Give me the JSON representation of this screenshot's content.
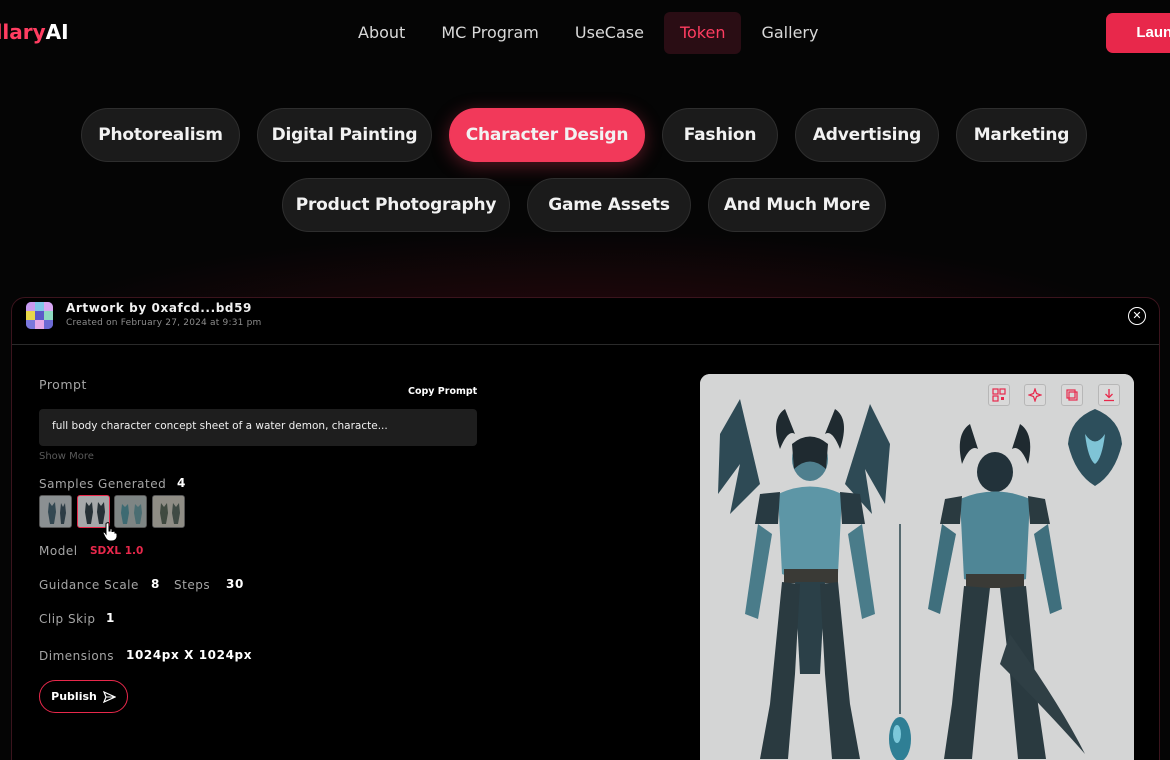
{
  "nav": {
    "logo_brand": "StellaryAI",
    "logo_brand_visible": "ellary",
    "logo_ai": "AI",
    "items": [
      "About",
      "MC Program",
      "UseCase",
      "Token",
      "Gallery"
    ],
    "active": "Token",
    "launch_label": "Launch"
  },
  "filters": {
    "items": [
      "Photorealism",
      "Digital Painting",
      "Character Design",
      "Fashion",
      "Advertising",
      "Marketing",
      "Product Photography",
      "Game Assets",
      "And Much More"
    ],
    "active": "Character Design"
  },
  "artwork_panel": {
    "artist": "Artwork by 0xafcd...bd59",
    "created": "Created on February 27, 2024 at 9:31 pm",
    "prompt_label": "Prompt",
    "copy_prompt": "Copy Prompt",
    "prompt_text": "full body character concept sheet of a water demon, characte...",
    "show_more": "Show More",
    "samples_label": "Samples Generated",
    "samples_count": "4",
    "model_label": "Model",
    "model_value": "SDXL 1.0",
    "guidance_label": "Guidance Scale",
    "guidance_value": "8",
    "steps_label": "Steps",
    "steps_value": "30",
    "clip_label": "Clip Skip",
    "clip_value": "1",
    "dimensions_label": "Dimensions",
    "dimensions_value": "1024px X 1024px",
    "publish_label": "Publish"
  },
  "colors": {
    "accent": "#e8284b",
    "chip_active": "#f2395a",
    "chip_bg": "#1b1b1b",
    "background": "#050505"
  },
  "icons": [
    "close-icon",
    "qr-icon",
    "sparkle-icon",
    "copy-icon",
    "download-icon",
    "send-icon",
    "hand-cursor-icon"
  ]
}
